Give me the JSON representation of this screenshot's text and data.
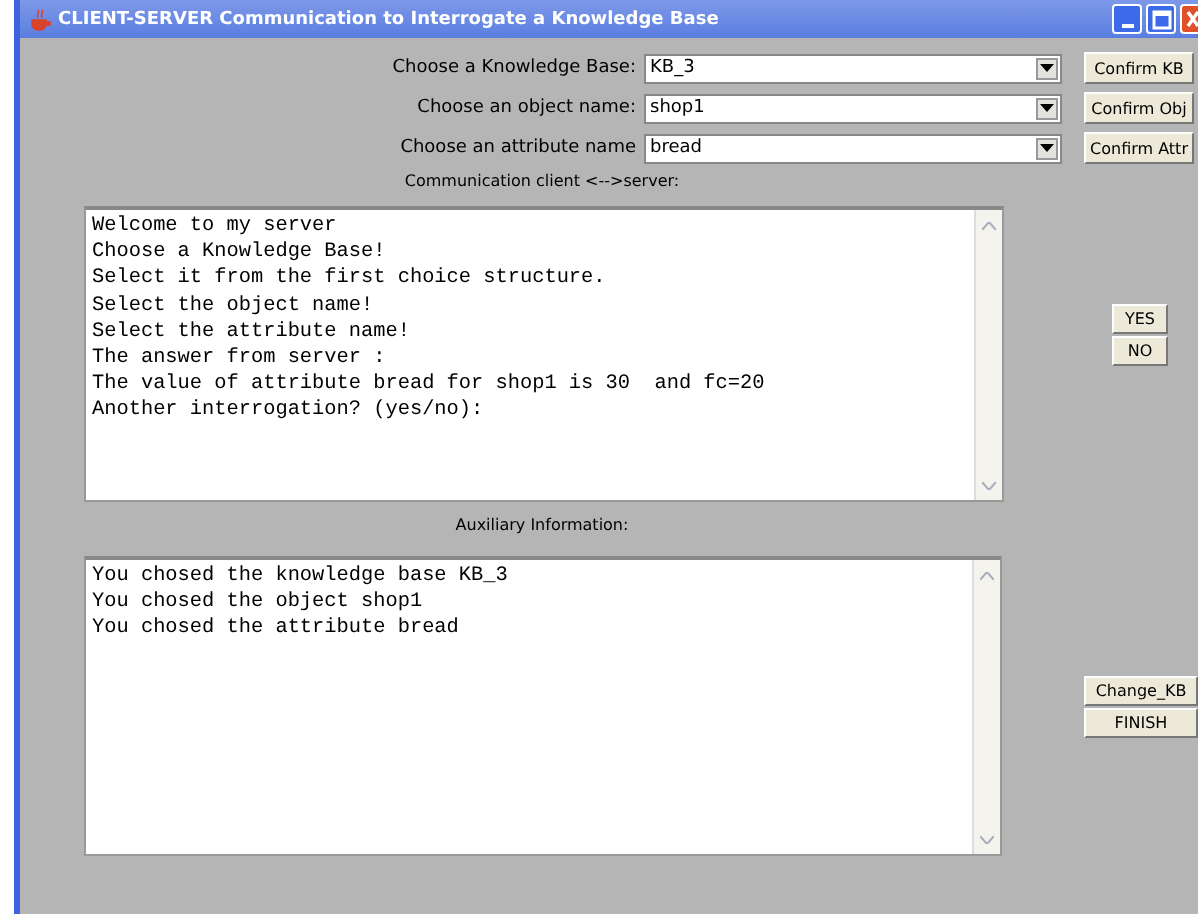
{
  "window": {
    "title": "CLIENT-SERVER Communication to Interrogate a Knowledge Base"
  },
  "selectors": [
    {
      "label": "Choose a Knowledge Base:",
      "value": "KB_3",
      "button": "Confirm KB"
    },
    {
      "label": "Choose an object name:",
      "value": "shop1",
      "button": "Confirm Obj"
    },
    {
      "label": "Choose an attribute name",
      "value": "bread",
      "button": "Confirm Attr"
    }
  ],
  "communication": {
    "label": "Communication client <-->server:",
    "lines": [
      "Welcome to my server",
      "Choose a Knowledge Base!",
      "Select it from the first choice structure.",
      "Select the object name!",
      "Select the attribute name!",
      "The answer from server :",
      "The value of attribute bread for shop1 is 30  and fc=20",
      "Another interrogation? (yes/no):"
    ],
    "buttons": [
      "YES",
      "NO"
    ]
  },
  "auxiliary": {
    "label": "Auxiliary Information:",
    "lines": [
      "You chosed the knowledge base KB_3",
      "You chosed the object shop1",
      "You chosed the attribute bread"
    ],
    "buttons": [
      "Change_KB",
      "FINISH"
    ]
  }
}
